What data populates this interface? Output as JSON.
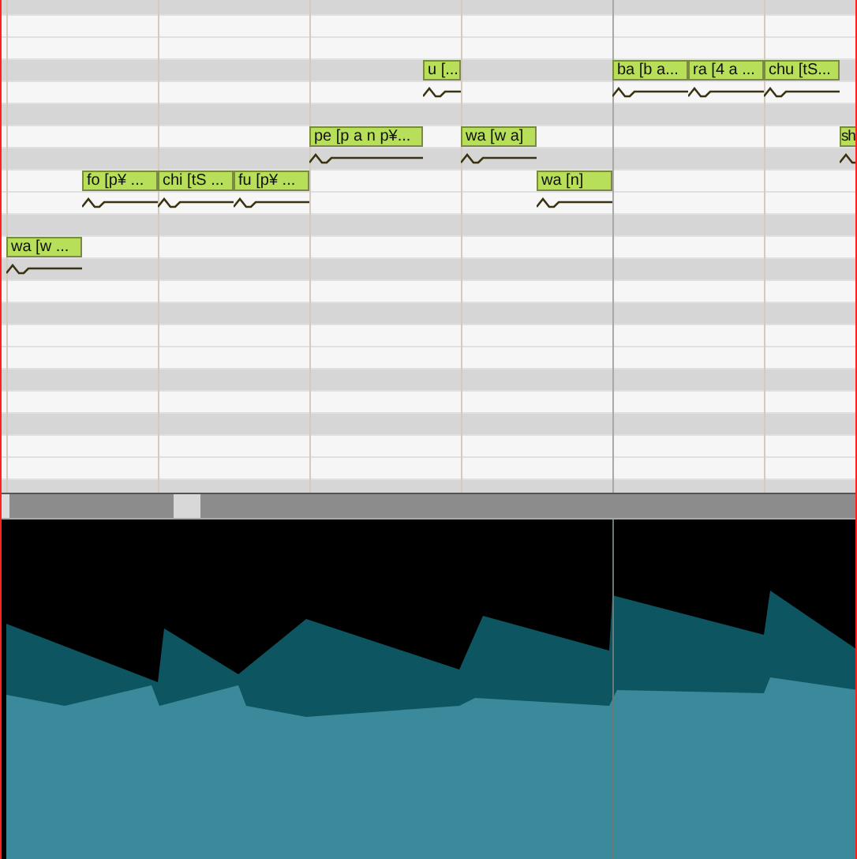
{
  "piano_roll": {
    "notes": [
      {
        "lyric": "wa [w ..."
      },
      {
        "lyric": "fo [p¥ ..."
      },
      {
        "lyric": "chi [tS ..."
      },
      {
        "lyric": "fu [p¥ ..."
      },
      {
        "lyric": "pe [p a n p¥..."
      },
      {
        "lyric": "u [..."
      },
      {
        "lyric": "wa [w a]"
      },
      {
        "lyric": "wa [n]"
      },
      {
        "lyric": "ba [b a..."
      },
      {
        "lyric": "ra [4 a ..."
      },
      {
        "lyric": "chu [tS..."
      },
      {
        "lyric": "sh"
      }
    ]
  }
}
